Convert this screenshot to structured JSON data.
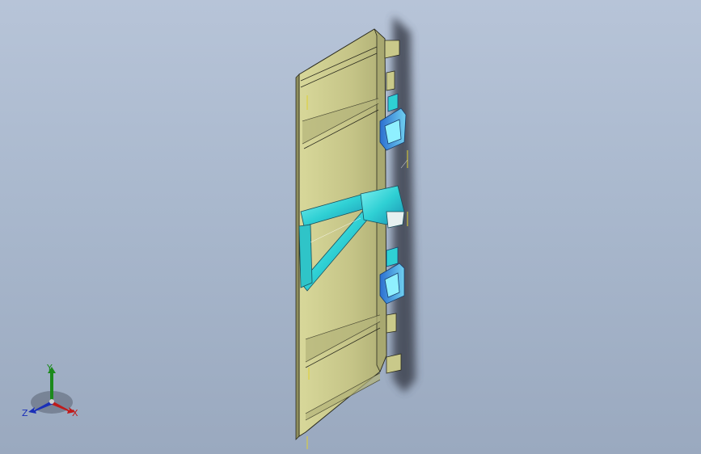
{
  "viewport": {
    "background_top": "#b7c4d8",
    "background_bottom": "#9aa9bf"
  },
  "model": {
    "body_color": "#c9c98a",
    "edge_color": "#2b2b1e",
    "bracket_color": "#2fd6d6",
    "bracket_highlight": "#3a7bd5"
  },
  "triad": {
    "x_label": "X",
    "y_label": "Y",
    "z_label": "Z",
    "x_color": "#c01a1a",
    "y_color": "#1c8a1c",
    "z_color": "#1a2fb8"
  }
}
